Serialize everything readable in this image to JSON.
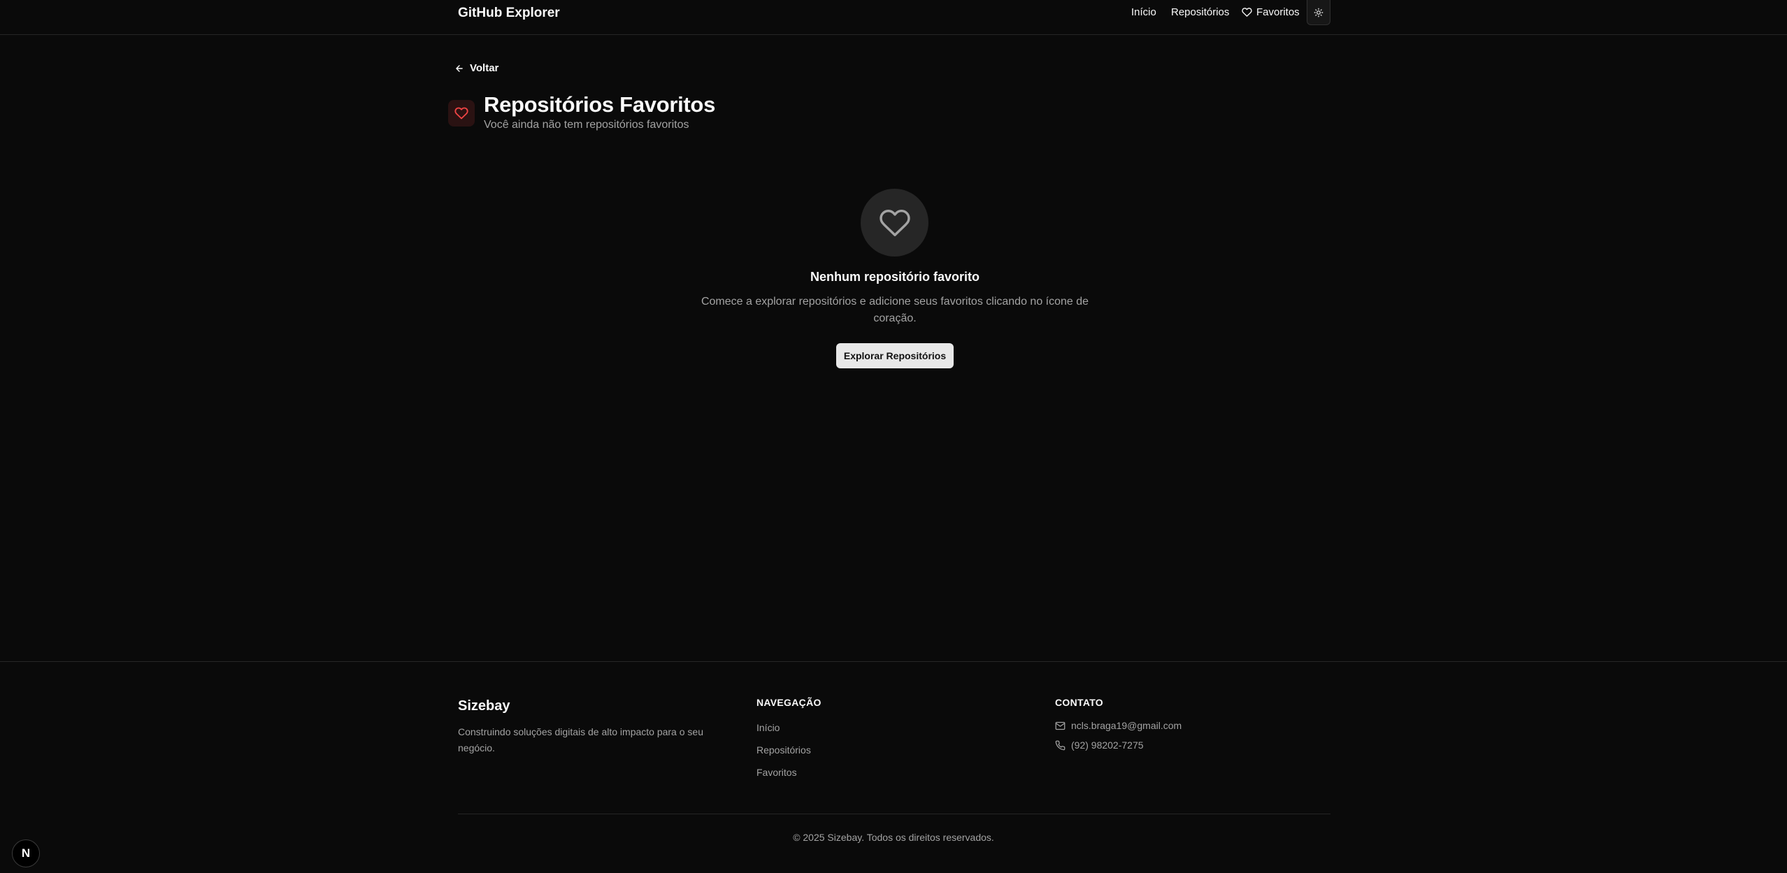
{
  "header": {
    "brand": "GitHub Explorer",
    "nav": {
      "inicio": "Início",
      "repositorios": "Repositórios",
      "favoritos": "Favoritos"
    },
    "theme_toggle_icon": "sun-icon"
  },
  "back": {
    "label": "Voltar",
    "icon": "arrow-left-icon"
  },
  "title_block": {
    "icon": "heart-icon",
    "title": "Repositórios Favoritos",
    "subtitle": "Você ainda não tem repositórios favoritos"
  },
  "empty_state": {
    "icon": "heart-icon",
    "title": "Nenhum repositório favorito",
    "description": "Comece a explorar repositórios e adicione seus favoritos clicando no ícone de coração.",
    "button_label": "Explorar Repositórios"
  },
  "footer": {
    "brand": "Sizebay",
    "description": "Construindo soluções digitais de alto impacto para o seu negócio.",
    "nav_heading": "NAVEGAÇÃO",
    "nav_links": [
      "Início",
      "Repositórios",
      "Favoritos"
    ],
    "contact_heading": "CONTATO",
    "email": "ncls.braga19@gmail.com",
    "phone": "(92) 98202-7275",
    "copyright": "© 2025 Sizebay. Todos os direitos reservados."
  },
  "dev_badge": "N",
  "colors": {
    "background": "#0a0a0a",
    "accent_red": "#ef4444",
    "muted_text": "#a3a3a3"
  }
}
